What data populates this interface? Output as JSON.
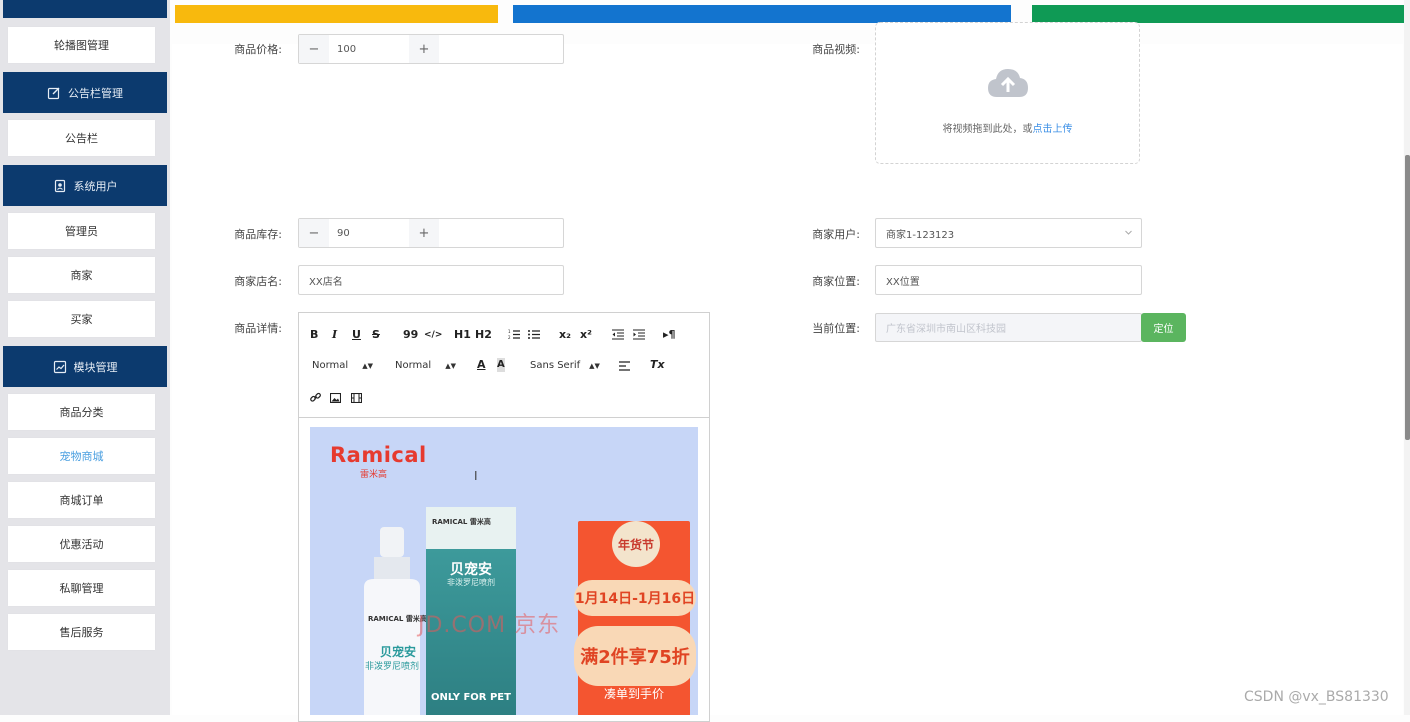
{
  "sidebar": {
    "items": [
      {
        "label": "轮播图管理"
      },
      {
        "group": "公告栏管理",
        "icon": "edit-icon"
      },
      {
        "label": "公告栏"
      },
      {
        "group": "系统用户",
        "icon": "user-badge-icon"
      },
      {
        "label": "管理员"
      },
      {
        "label": "商家"
      },
      {
        "label": "买家"
      },
      {
        "group": "模块管理",
        "icon": "chart-icon"
      },
      {
        "label": "商品分类"
      },
      {
        "label": "宠物商城",
        "active": true
      },
      {
        "label": "商城订单"
      },
      {
        "label": "优惠活动"
      },
      {
        "label": "私聊管理"
      },
      {
        "label": "售后服务"
      }
    ]
  },
  "colors": {
    "bar_yellow": "#f8b90d",
    "bar_blue": "#1374cf",
    "bar_green": "#0f9a55",
    "sidebar_dark": "#0c3a6e",
    "active_link": "#4a9fe0",
    "locate_button": "#5bb55f"
  },
  "form": {
    "price": {
      "label": "商品价格:",
      "value": "100"
    },
    "video": {
      "label": "商品视频:",
      "hint": "将视频拖到此处，或",
      "link": "点击上传"
    },
    "stock": {
      "label": "商品库存:",
      "value": "90"
    },
    "merchant_user": {
      "label": "商家用户:",
      "value": "商家1-123123"
    },
    "shop_name": {
      "label": "商家店名:",
      "value": "XX店名"
    },
    "merchant_location": {
      "label": "商家位置:",
      "value": "XX位置"
    },
    "detail": {
      "label": "商品详情:"
    },
    "current_location": {
      "label": "当前位置:",
      "value": "广东省深圳市南山区科技园",
      "button": "定位"
    }
  },
  "editor": {
    "toolbar": {
      "bold": "B",
      "italic": "I",
      "underline": "U",
      "strike": "S",
      "quote": "99",
      "code": "</>",
      "h1": "H1",
      "h2": "H2",
      "sub": "x₂",
      "sup": "x²",
      "size_select": "Normal",
      "header_select": "Normal",
      "font_select": "Sans Serif",
      "clean": "Tx"
    },
    "image": {
      "brand": "Ramical",
      "brand_cn": "雷米高",
      "box_brand": "RAMICAL 雷米高",
      "product_name": "贝宠安",
      "product_sub": "非泼罗尼喷剂",
      "spray_brand": "RAMICAL 雷米高",
      "only_for_pet": "ONLY FOR PET",
      "badge": "年货节",
      "dates": "1月14日-1月16日",
      "deal": "满2件享75折",
      "price_text": "凑单到手价",
      "watermark": "JD.COM 京东"
    }
  },
  "watermark": "CSDN @vx_BS81330"
}
